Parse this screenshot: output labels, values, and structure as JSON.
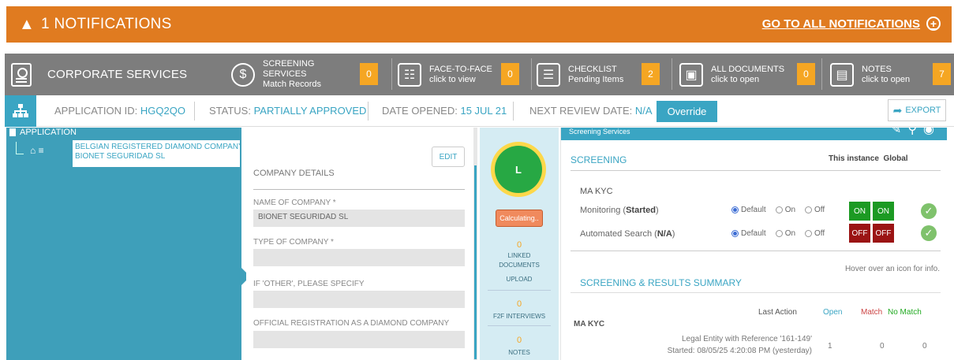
{
  "notifications": {
    "title": "1 NOTIFICATIONS",
    "goto_label": "GO TO ALL NOTIFICATIONS",
    "bar_color": "#e07b20"
  },
  "services": {
    "corporate_label": "CORPORATE SERVICES",
    "tiles": [
      {
        "title": "SCREENING SERVICES",
        "subtitle": "Match Records",
        "count": "0",
        "icon": "screening-icon"
      },
      {
        "title": "FACE-TO-FACE",
        "subtitle": "click to view",
        "count": "0",
        "icon": "face-to-face-icon"
      },
      {
        "title": "CHECKLIST",
        "subtitle": "Pending Items",
        "count": "2",
        "icon": "checklist-icon"
      },
      {
        "title": "ALL DOCUMENTS",
        "subtitle": "click to open",
        "count": "0",
        "icon": "documents-icon"
      },
      {
        "title": "NOTES",
        "subtitle": "click to open",
        "count": "7",
        "icon": "notes-icon"
      }
    ]
  },
  "app_info": {
    "app_id_label": "APPLICATION ID:",
    "app_id": "HGQ2QO",
    "status_label": "STATUS:",
    "status": "PARTIALLY APPROVED",
    "opened_label": "DATE OPENED:",
    "opened": "15 JUL 21",
    "review_label": "NEXT REVIEW DATE:",
    "review": "N/A",
    "override": "Override",
    "export": "EXPORT",
    "accent": "#3aa5c3"
  },
  "tree": {
    "header": "APPLICATION",
    "node_line1": "BELGIAN REGISTERED DIAMOND COMPANY",
    "node_line2": "BIONET SEGURIDAD SL"
  },
  "form": {
    "edit": "EDIT",
    "section": "COMPANY DETAILS",
    "name_label": "NAME OF COMPANY *",
    "name_value": "BIONET SEGURIDAD SL",
    "type_label": "TYPE OF COMPANY *",
    "other_label": "IF 'OTHER', PLEASE SPECIFY",
    "registration_label": "OFFICIAL REGISTRATION AS A DIAMOND COMPANY"
  },
  "middle": {
    "badge": "L",
    "calculating": "Calculating..",
    "linked_count": "0",
    "linked_label1": "LINKED",
    "linked_label2": "DOCUMENTS",
    "upload": "UPLOAD",
    "f2f_count": "0",
    "f2f_label": "F2F INTERVIEWS",
    "notes_count": "0",
    "notes_label": "NOTES"
  },
  "screening": {
    "header": "Screening Services",
    "title": "SCREENING",
    "this_instance": "This instance",
    "global": "Global",
    "kyc": "MA KYC",
    "monitoring_label": "Monitoring (",
    "monitoring_status": "Started",
    "automated_label": "Automated Search (",
    "automated_status": "N/A",
    "close_paren": ")",
    "opt_default": "Default",
    "opt_on": "On",
    "opt_off": "Off",
    "on": "ON",
    "off": "OFF",
    "hover_hint": "Hover over an icon for info.",
    "summary_title": "SCREENING & RESULTS SUMMARY",
    "col_last_action": "Last Action",
    "col_open": "Open",
    "col_match": "Match",
    "col_nomatch": "No Match",
    "row_kyc": "MA KYC",
    "row_line1": "Legal Entity with Reference '161-149'",
    "row_line2": "Started: 08/05/25 4:20:08 PM (yesterday)",
    "row_open": "1",
    "row_match": "0",
    "row_nomatch": "0"
  }
}
